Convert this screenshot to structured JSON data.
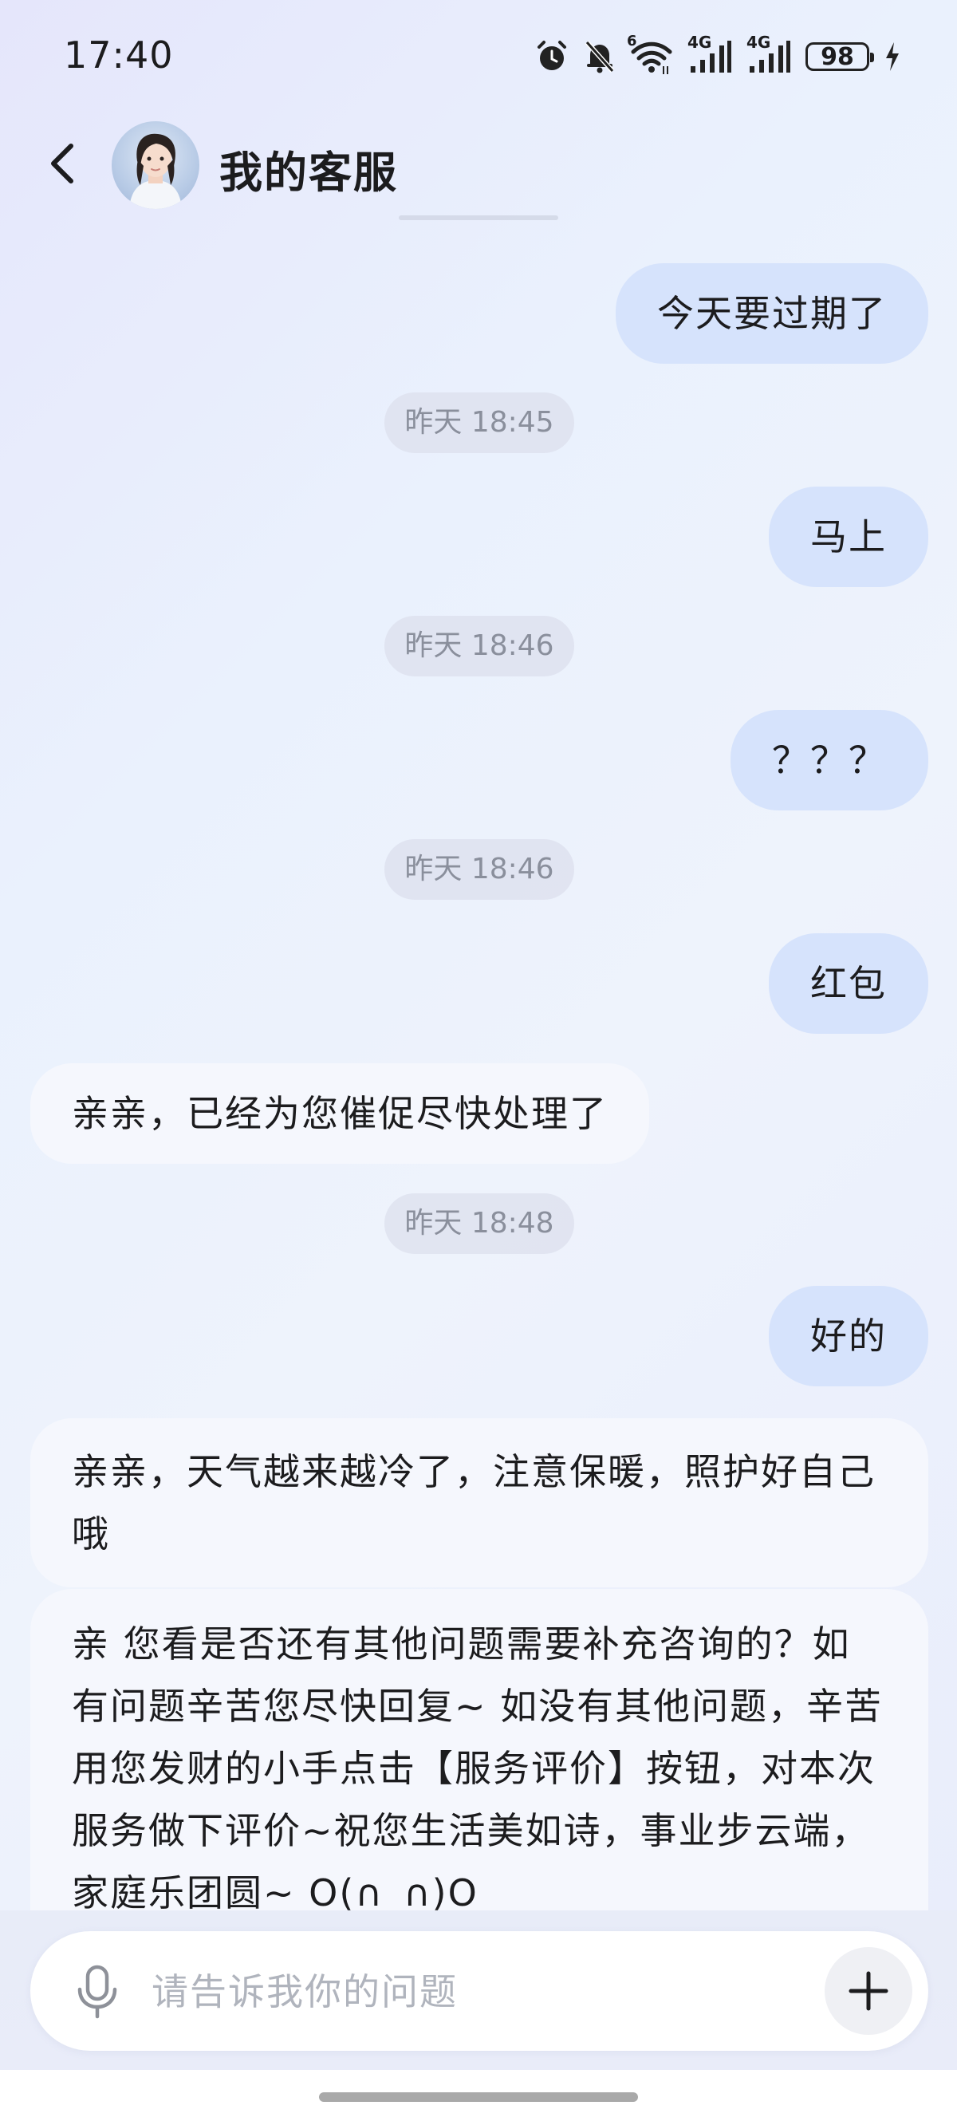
{
  "status_bar": {
    "time": "17:40",
    "network_1": "4G",
    "network_2": "4G",
    "wifi_badge": "6",
    "battery": "98"
  },
  "header": {
    "title": "我的客服"
  },
  "messages": [
    {
      "type": "outgoing",
      "text": "今天要过期了"
    },
    {
      "type": "timestamp",
      "text": "昨天 18:45"
    },
    {
      "type": "outgoing",
      "text": "马上"
    },
    {
      "type": "timestamp",
      "text": "昨天 18:46"
    },
    {
      "type": "outgoing",
      "text": "？？？"
    },
    {
      "type": "timestamp",
      "text": "昨天 18:46"
    },
    {
      "type": "outgoing",
      "text": "红包"
    },
    {
      "type": "incoming",
      "text": "亲亲，已经为您催促尽快处理了"
    },
    {
      "type": "timestamp",
      "text": "昨天 18:48"
    },
    {
      "type": "outgoing",
      "text": "好的"
    },
    {
      "type": "incoming",
      "text": "亲亲，天气越来越冷了，注意保暖，照护好自己哦"
    },
    {
      "type": "incoming",
      "text": "亲 您看是否还有其他问题需要补充咨询的？如有问题辛苦您尽快回复~ 如没有其他问题，辛苦用您发财的小手点击【服务评价】按钮，对本次服务做下评价~祝您生活美如诗，事业步云端，家庭乐团圆~ O(∩_∩)O"
    }
  ],
  "input": {
    "placeholder": "请告诉我你的问题",
    "value": ""
  },
  "icons": {
    "back": "chevron-left-icon",
    "avatar": "agent-avatar",
    "mic": "microphone-icon",
    "plus": "plus-icon",
    "alarm": "alarm-icon",
    "mute": "bell-off-icon",
    "wifi": "wifi-icon",
    "signal": "signal-icon",
    "charging": "bolt-icon"
  }
}
